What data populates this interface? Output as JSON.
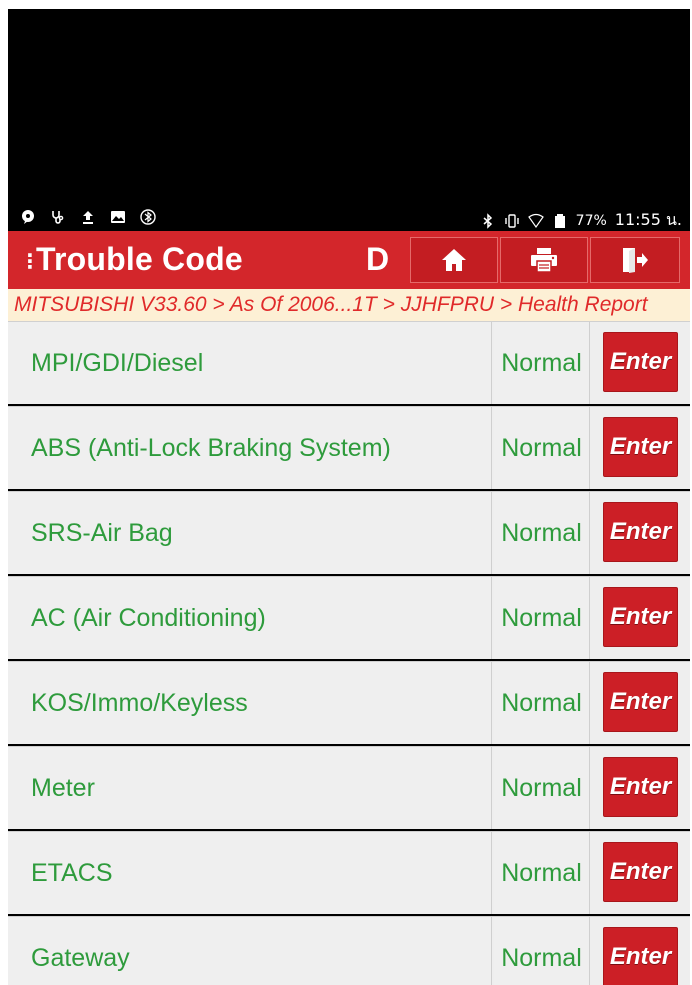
{
  "statusbar": {
    "battery": "77%",
    "time": "11:55 น."
  },
  "titlebar": {
    "menu_glyph": "⋮",
    "title": "Trouble Code",
    "letter": "D"
  },
  "breadcrumb": {
    "text": "MITSUBISHI V33.60 > As Of 2006...1T > JJHFPRU > Health Report"
  },
  "rows": [
    {
      "name": "MPI/GDI/Diesel",
      "status": "Normal",
      "action": "Enter"
    },
    {
      "name": "ABS (Anti-Lock Braking System)",
      "status": "Normal",
      "action": "Enter"
    },
    {
      "name": "SRS-Air Bag",
      "status": "Normal",
      "action": "Enter"
    },
    {
      "name": "AC (Air Conditioning)",
      "status": "Normal",
      "action": "Enter"
    },
    {
      "name": "KOS/Immo/Keyless",
      "status": "Normal",
      "action": "Enter"
    },
    {
      "name": "Meter",
      "status": "Normal",
      "action": "Enter"
    },
    {
      "name": "ETACS",
      "status": "Normal",
      "action": "Enter"
    },
    {
      "name": "Gateway",
      "status": "Normal",
      "action": "Enter"
    }
  ],
  "colors": {
    "title_bar": "#d3262b",
    "breadcrumb_bg": "#fdf0d5",
    "breadcrumb_text": "#e02a2a",
    "row_text": "#2e9b3c",
    "enter_button": "#cc1f26"
  },
  "icons": {
    "home": "home-icon",
    "print": "printer-icon",
    "exit": "exit-icon"
  }
}
